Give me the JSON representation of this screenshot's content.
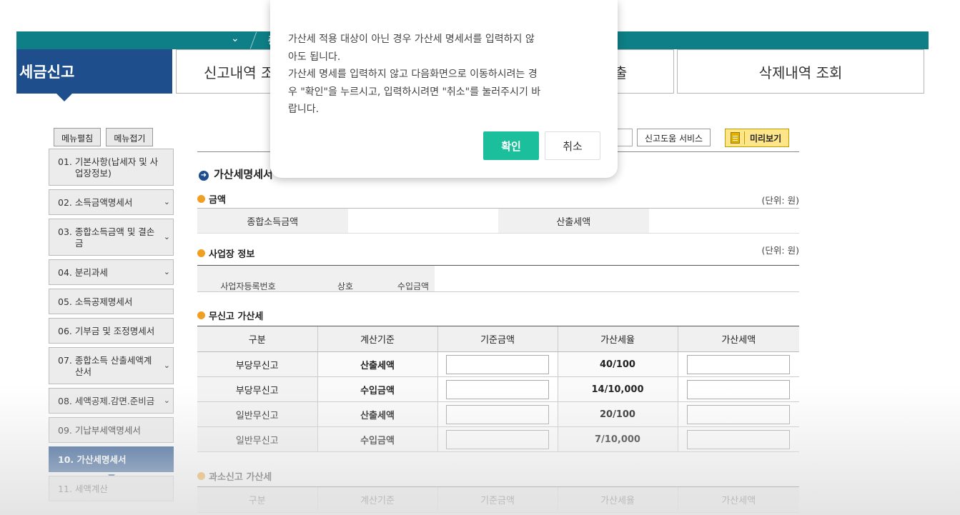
{
  "header": {
    "breadcrumb_chevron": "⌄",
    "breadcrumb_text": "종합",
    "active_tab": "세금신고",
    "tabs": [
      "신고내역 조",
      "출",
      "삭제내역 조회"
    ]
  },
  "sidebar": {
    "menu_edit": "메뉴펼침",
    "menu_collapse": "메뉴접기",
    "items": [
      {
        "line1": "01. 기본사항(납세자 및 사",
        "line2": "업장정보)",
        "arrow": ""
      },
      {
        "line1": "02. 소득금액명세서",
        "line2": "",
        "arrow": "⌄"
      },
      {
        "line1": "03. 종합소득금액 및 결손",
        "line2": "금",
        "arrow": "⌄"
      },
      {
        "line1": "04. 분리과세",
        "line2": "",
        "arrow": "⌄"
      },
      {
        "line1": "05. 소득공제명세서",
        "line2": "",
        "arrow": ""
      },
      {
        "line1": "06. 기부금 및 조정명세서",
        "line2": "",
        "arrow": ""
      },
      {
        "line1": "07. 종합소득 산출세액계",
        "line2": "산서",
        "arrow": "⌄"
      },
      {
        "line1": "08. 세액공제.감면.준비금",
        "line2": "",
        "arrow": "⌄"
      },
      {
        "line1": "09. 기납부세액명세서",
        "line2": "",
        "arrow": ""
      },
      {
        "line1": "10. 가산세명세서",
        "line2": "",
        "arrow": ""
      },
      {
        "line1": "11. 세액계산",
        "line2": "",
        "arrow": ""
      }
    ]
  },
  "toolbar": {
    "help": "신고도움 서비스",
    "preview": "미리보기"
  },
  "page": {
    "title": "가산세명세서"
  },
  "amount_section": {
    "title": "금액",
    "unit": "(단위: 원)",
    "label1": "종합소득금액",
    "label2": "산출세액"
  },
  "biz_section": {
    "title": "사업장 정보",
    "unit": "(단위: 원)",
    "headers": [
      "사업자등록번호",
      "상호",
      "수입금액"
    ]
  },
  "nonfiling_section": {
    "title": "무신고 가산세",
    "headers": [
      "구분",
      "계산기준",
      "기준금액",
      "가산세율",
      "가산세액"
    ],
    "rows": [
      {
        "type": "부당무신고",
        "basis": "산출세액",
        "rate": "40/100"
      },
      {
        "type": "부당무신고",
        "basis": "수입금액",
        "rate": "14/10,000"
      },
      {
        "type": "일반무신고",
        "basis": "산출세액",
        "rate": "20/100"
      },
      {
        "type": "일반무신고",
        "basis": "수입금액",
        "rate": "7/10,000"
      }
    ]
  },
  "underreport_section": {
    "title": "과소신고 가산세",
    "headers": [
      "구분",
      "계산기준",
      "기준금액",
      "가산세율",
      "가산세액"
    ]
  },
  "dialog": {
    "line1": "가산세 적용 대상이 아닌 경우 가산세 명세서를 입력하지 않",
    "line2": "아도 됩니다.",
    "line3": "가산세 명세를 입력하지 않고 다음화면으로 이동하시려는 경",
    "line4": "우 \"확인\"을 누르시고, 입력하시려면 \"취소\"를 눌러주시기 바",
    "line5": "랍니다.",
    "ok": "확인",
    "cancel": "취소"
  }
}
